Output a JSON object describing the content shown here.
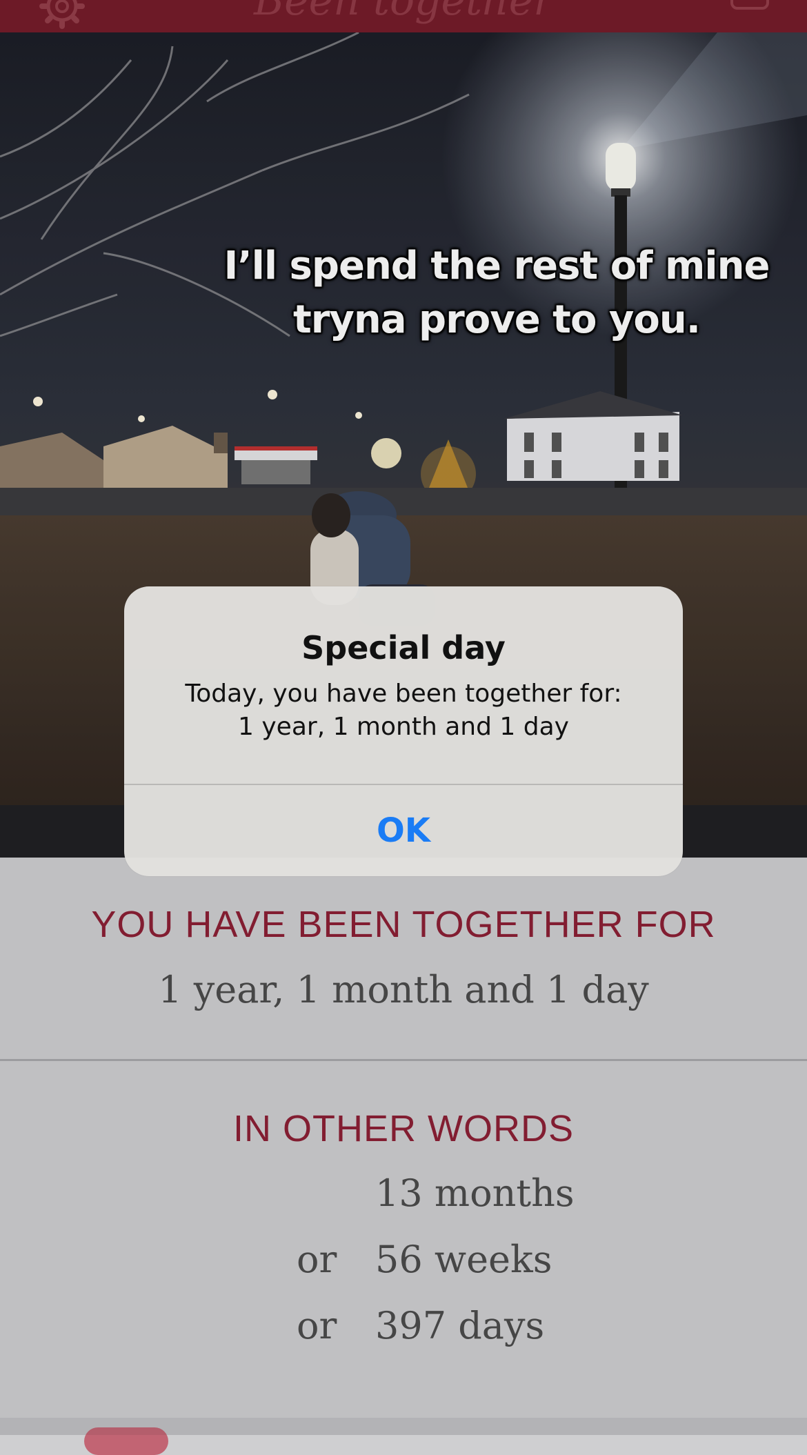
{
  "header": {
    "title": "Been together",
    "icons": [
      "gear-icon",
      "calendar-icon"
    ]
  },
  "photo": {
    "caption_line1": "I’ll spend the rest of mine",
    "caption_line2": "tryna prove to you."
  },
  "together": {
    "heading": "YOU HAVE BEEN TOGETHER FOR",
    "value": "1 year, 1 month and 1 day"
  },
  "other_words": {
    "heading": "IN OTHER WORDS",
    "or_label": "or",
    "rows": [
      {
        "prefix": "",
        "value": "13 months"
      },
      {
        "prefix": "or",
        "value": "56 weeks"
      },
      {
        "prefix": "or",
        "value": "397 days"
      }
    ]
  },
  "alert": {
    "title": "Special day",
    "message_line1": "Today, you have been together for:",
    "message_line2": "1 year, 1 month and 1 day",
    "ok_label": "OK"
  },
  "colors": {
    "header_bg": "#6d1a27",
    "accent_red": "#8b1e33",
    "ios_blue": "#1a7cf5",
    "page_bg": "#cfcfd1"
  }
}
